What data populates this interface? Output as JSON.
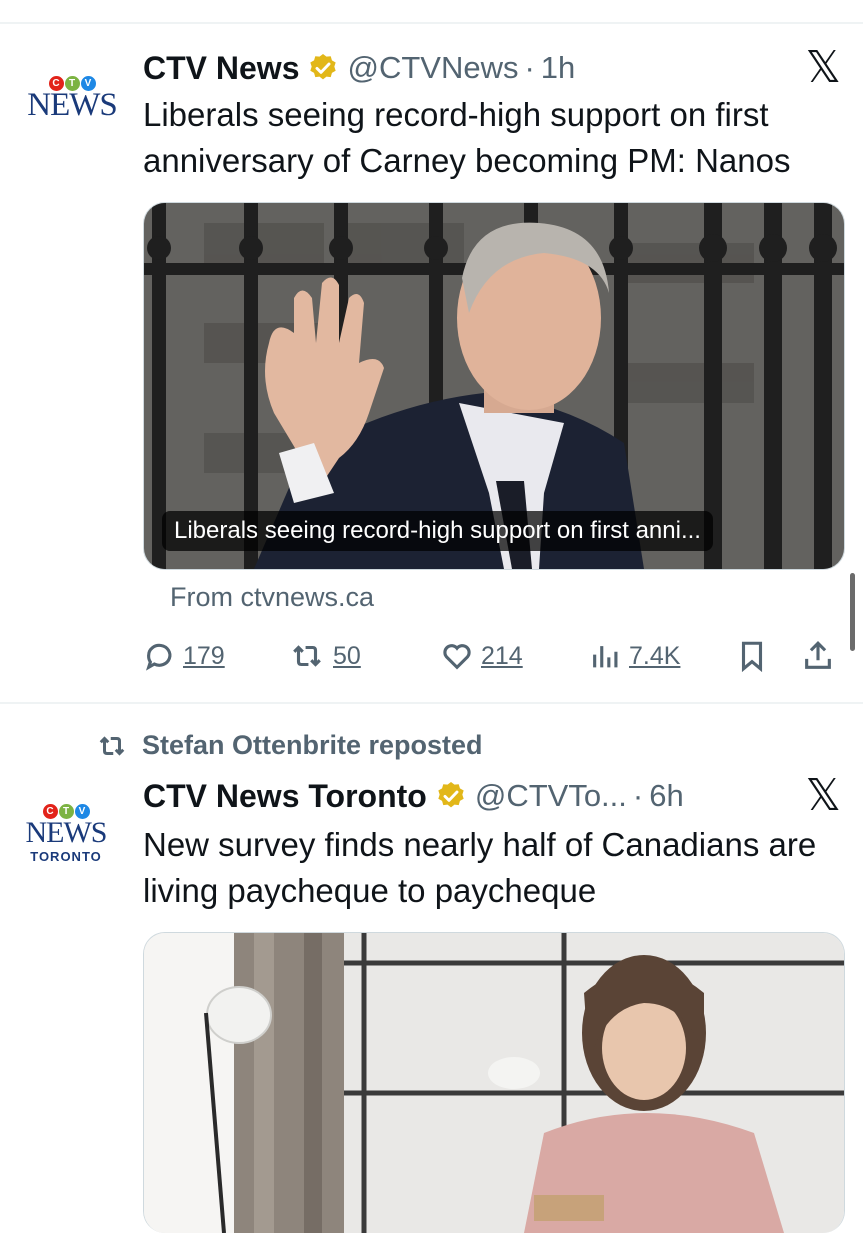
{
  "tweets": [
    {
      "author_name": "CTV News",
      "handle": "@CTVNews",
      "time": "1h",
      "separator": "·",
      "avatar": {
        "top": "CTV",
        "word": "NEWS",
        "sub": ""
      },
      "text": "Liberals seeing record-high support on first anniversary of Carney becoming PM: Nanos",
      "card": {
        "caption": "Liberals seeing record-high support on first anni...",
        "source": "From ctvnews.ca"
      },
      "actions": {
        "replies": "179",
        "reposts": "50",
        "likes": "214",
        "views": "7.4K"
      },
      "icons": [
        "verified-badge-icon",
        "x-logo-icon",
        "reply-icon",
        "repost-icon",
        "like-icon",
        "views-icon",
        "bookmark-icon",
        "share-icon"
      ]
    },
    {
      "reposted_by": "Stefan Ottenbrite reposted",
      "author_name": "CTV News Toronto",
      "handle": "@CTVTo...",
      "time": "6h",
      "separator": "·",
      "avatar": {
        "top": "CTV",
        "word": "NEWS",
        "sub": "TORONTO"
      },
      "text": "New survey finds nearly half of Canadians are living paycheque to paycheque"
    }
  ],
  "colors": {
    "text_primary": "#0f1419",
    "text_secondary": "#536471",
    "verified_gold": "#e2b719",
    "ctv_red": "#e2231a",
    "ctv_blue": "#1a3a7a"
  }
}
